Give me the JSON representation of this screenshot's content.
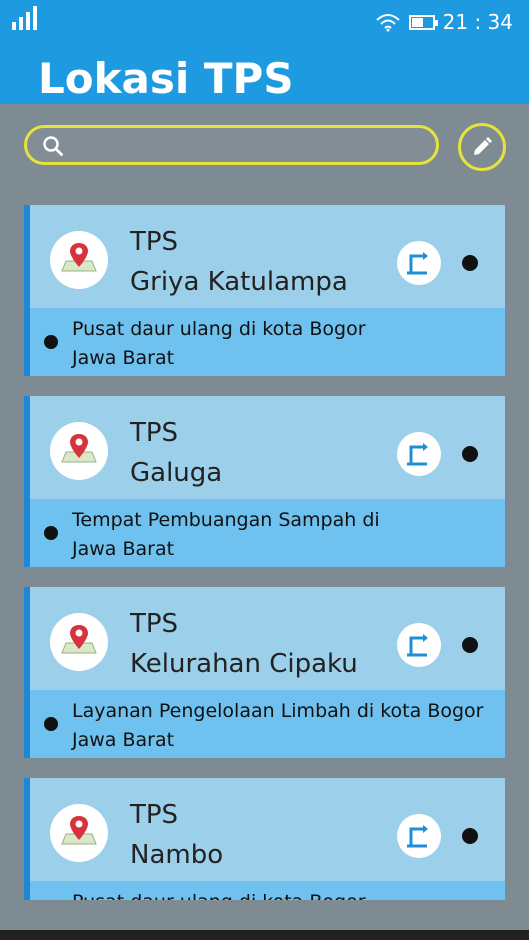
{
  "status": {
    "time": "21 : 34",
    "battery_level": 0.55
  },
  "header": {
    "title": "Lokasi TPS"
  },
  "search": {
    "placeholder": ""
  },
  "colors": {
    "primary": "#1e9ae0",
    "accent": "#e6e33a",
    "background": "#7f8b93"
  },
  "items": [
    {
      "label": "TPS",
      "name": "Griya Katulampa",
      "desc1": "Pusat daur ulang di kota Bogor",
      "desc2": "Jawa Barat"
    },
    {
      "label": "TPS",
      "name": "Galuga",
      "desc1": "Tempat Pembuangan Sampah di",
      "desc2": "Jawa Barat"
    },
    {
      "label": "TPS",
      "name": "Kelurahan Cipaku",
      "desc1": "Layanan Pengelolaan Limbah di kota Bogor",
      "desc2": "Jawa Barat"
    },
    {
      "label": "TPS",
      "name": "Nambo",
      "desc1": "Pusat daur ulang di kota Bogor",
      "desc2": ""
    }
  ]
}
